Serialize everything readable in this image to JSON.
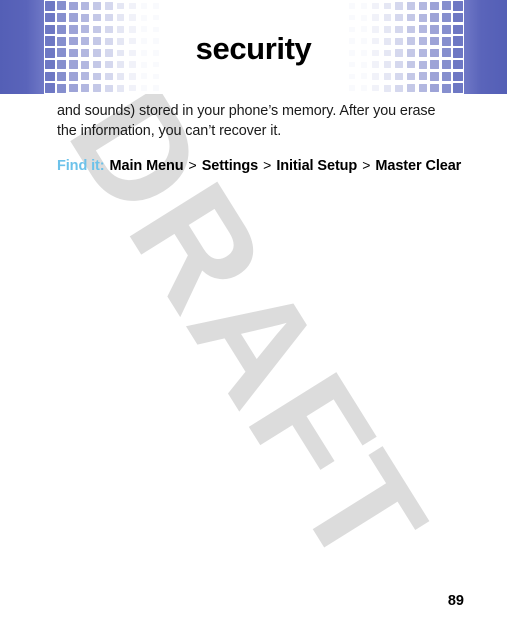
{
  "document": {
    "chapter_title": "security",
    "page_number": "89",
    "watermark": "DRAFT"
  },
  "header": {
    "title": "security",
    "band_color": "#545fb6",
    "square_color": "#6e78c4",
    "square_rows": 8,
    "square_columns": 10
  },
  "body": {
    "paragraph": "and sounds) stored in your phone’s memory. After you erase the information, you can’t recover it."
  },
  "find_it": {
    "label": "Find it:",
    "label_color": "#6cc2ea",
    "separator": ">",
    "path": [
      "Main Menu",
      "Settings",
      "Initial Setup",
      "Master Clear"
    ]
  }
}
